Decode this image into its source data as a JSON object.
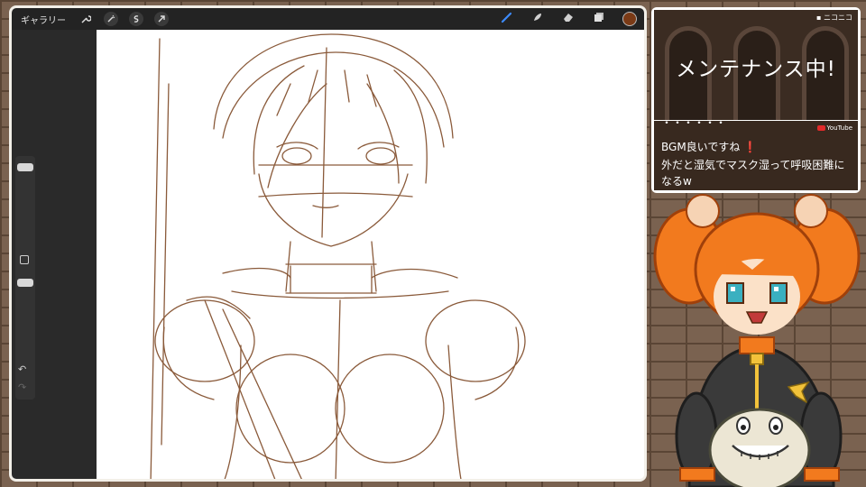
{
  "procreate": {
    "gallery_label": "ギャラリー",
    "tool_icons": [
      "wrench-icon",
      "magic-wand-icon",
      "selection-icon",
      "transform-arrow-icon"
    ],
    "right_tools": [
      "brush-icon",
      "smudge-icon",
      "eraser-icon",
      "layers-icon"
    ],
    "active_tool": "brush-icon",
    "current_color": "#7a3a16",
    "sidebar": {
      "undo_glyph": "↶",
      "redo_glyph": "↷"
    }
  },
  "widget": {
    "badge": "▪ ニコニコ",
    "title": "メンテナンス中!",
    "platform": "YouTube",
    "chat": {
      "cut_line": "・・・・・・",
      "messages": [
        "BGM良いですね ❗",
        "外だと湿気でマスク湿って呼吸困難になるw"
      ]
    }
  },
  "colors": {
    "sketch": "#8a5a3a",
    "hair": "#f27a1e",
    "outfit": "#3a3a3a"
  }
}
